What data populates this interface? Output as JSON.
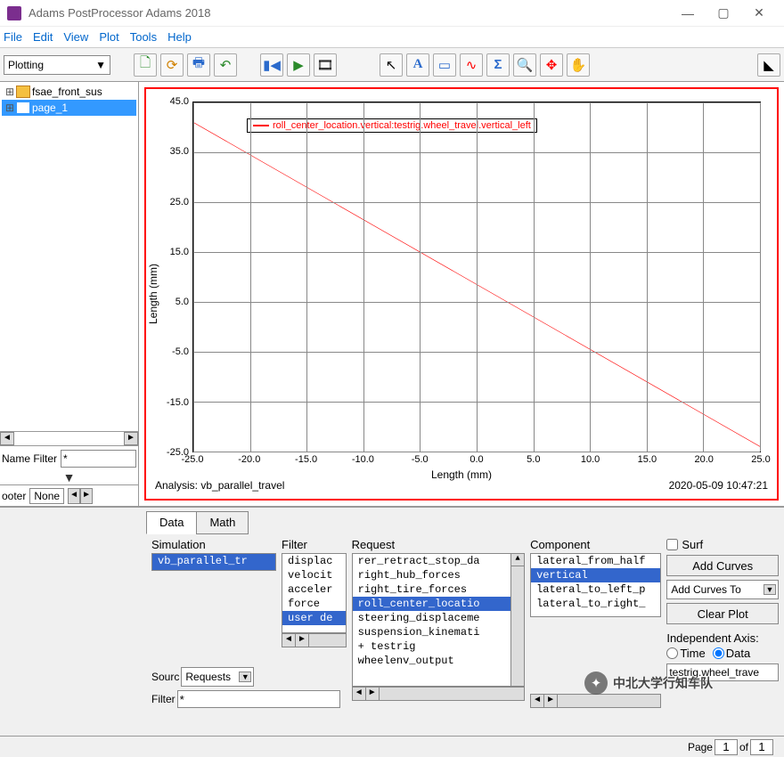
{
  "window": {
    "title": "Adams PostProcessor Adams 2018"
  },
  "menu": [
    "File",
    "Edit",
    "View",
    "Plot",
    "Tools",
    "Help"
  ],
  "toolbar": {
    "mode": "Plotting"
  },
  "tree": {
    "items": [
      {
        "label": "fsae_front_sus",
        "selected": false,
        "kind": "folder"
      },
      {
        "label": "page_1",
        "selected": true,
        "kind": "page"
      }
    ]
  },
  "name_filter": {
    "label": "Name Filter",
    "value": "*"
  },
  "footer": {
    "label": "ooter",
    "value": "None"
  },
  "chart_data": {
    "type": "line",
    "title": "",
    "xlabel": "Length (mm)",
    "ylabel": "Length (mm)",
    "xlim": [
      -25.0,
      25.0
    ],
    "ylim": [
      -25.0,
      45.0
    ],
    "x_ticks": [
      -25.0,
      -20.0,
      -15.0,
      -10.0,
      -5.0,
      0.0,
      5.0,
      10.0,
      15.0,
      20.0,
      25.0
    ],
    "y_ticks": [
      -25.0,
      -15.0,
      -5.0,
      5.0,
      15.0,
      25.0,
      35.0,
      45.0
    ],
    "series": [
      {
        "name": "roll_center_location.vertical:testrig.wheel_travel.vertical_left",
        "color": "red",
        "x": [
          -25.0,
          25.0
        ],
        "y": [
          41.0,
          -24.0
        ]
      }
    ],
    "analysis_label": "Analysis: vb_parallel_travel",
    "timestamp": "2020-05-09 10:47:21"
  },
  "bottom": {
    "tabs": [
      "Data",
      "Math"
    ],
    "active_tab": 0,
    "simulation": {
      "header": "Simulation",
      "items": [
        "vb_parallel_tr"
      ],
      "selected": 0
    },
    "filter_list": {
      "header": "Filter",
      "items": [
        "displac",
        "velocit",
        "acceler",
        "force",
        "user de"
      ],
      "selected": 4
    },
    "request": {
      "header": "Request",
      "items": [
        "rer_retract_stop_da",
        "right_hub_forces",
        "right_tire_forces",
        "roll_center_locatio",
        "steering_displaceme",
        "suspension_kinemati",
        "+ testrig",
        "wheelenv_output"
      ],
      "selected": 3
    },
    "component": {
      "header": "Component",
      "items": [
        "lateral_from_half",
        "vertical",
        "lateral_to_left_p",
        "lateral_to_right_"
      ],
      "selected": 1
    },
    "source": {
      "label": "Sourc",
      "value": "Requests"
    },
    "filter_text": {
      "label": "Filter",
      "value": "*"
    },
    "surf": {
      "label": "Surf",
      "checked": false
    },
    "add_curves_btn": "Add Curves",
    "add_curves_to": "Add Curves To",
    "clear_plot_btn": "Clear Plot",
    "indep_axis": {
      "label": "Independent Axis:",
      "options": [
        "Time",
        "Data"
      ],
      "selected": 1
    },
    "indep_value": "testrig.wheel_trave"
  },
  "status": {
    "page_label": "Page",
    "of_label": "of",
    "current": "1",
    "total": "1"
  },
  "watermark": "中北大学行知车队"
}
